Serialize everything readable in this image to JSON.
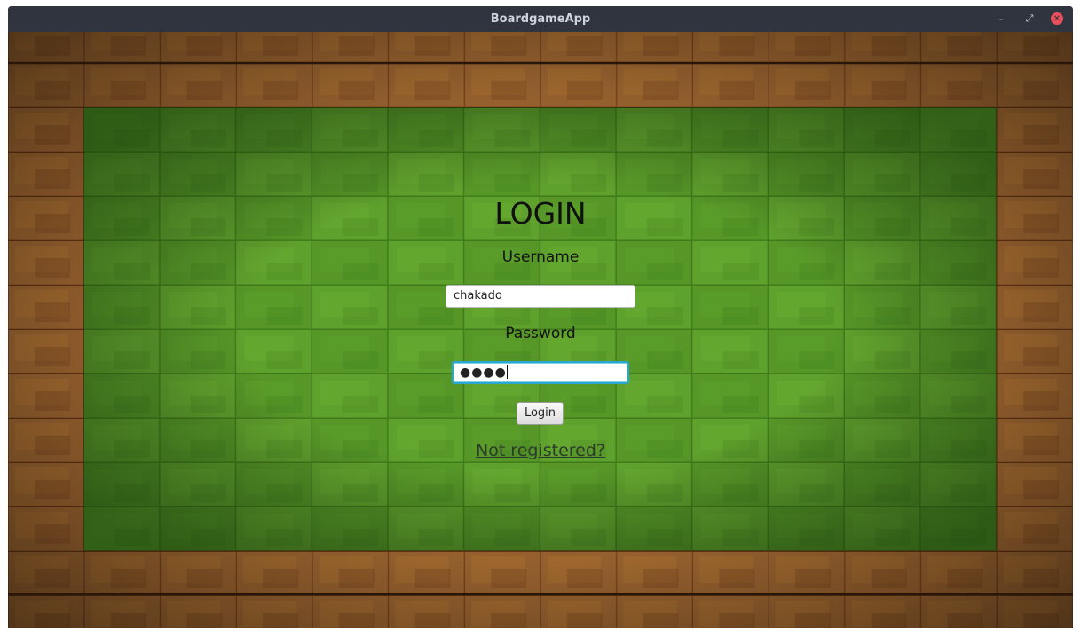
{
  "window": {
    "title": "BoardgameApp",
    "controls": {
      "minimize": "–",
      "maximize": "⤢",
      "close": "✕"
    }
  },
  "login": {
    "heading": "LOGIN",
    "username_label": "Username",
    "username_value": "chakado",
    "password_label": "Password",
    "password_value": "●●●●",
    "login_button": "Login",
    "register_link": "Not registered?"
  },
  "colors": {
    "titlebar": "#2f343f",
    "grass": "#5a9a2a",
    "wood": "#7a4a25",
    "focus_border": "#2aa8d4",
    "close_button": "#e8505b"
  }
}
